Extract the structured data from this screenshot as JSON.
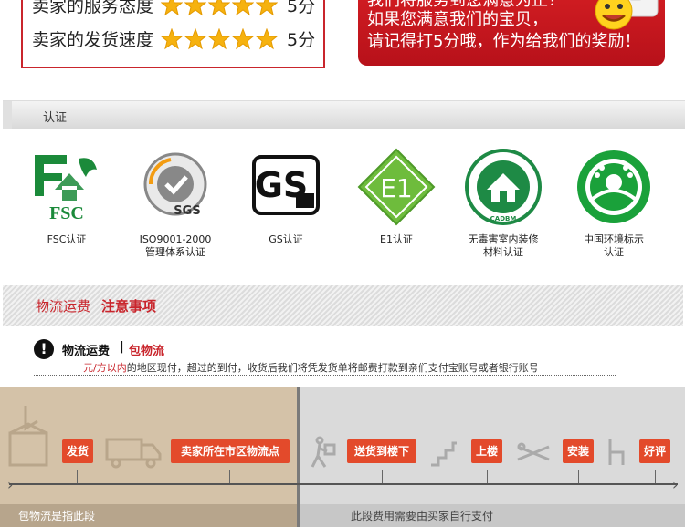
{
  "ratings": [
    {
      "label": "卖家的服务态度",
      "score": "5分",
      "stars": 5
    },
    {
      "label": "卖家的发货速度",
      "score": "5分",
      "stars": 5
    }
  ],
  "banner": {
    "line1": "我们将服务到您满意为止！",
    "line2": "如果您满意我们的宝贝，",
    "line3": "请记得打5分哦，作为给我们的奖励！"
  },
  "cert_section": {
    "title": "认证",
    "items": [
      {
        "caption": "FSC认证",
        "icon": "fsc-icon",
        "logo_text": "FSC"
      },
      {
        "caption": "ISO9001-2000\n管理体系认证",
        "icon": "sgs-icon",
        "logo_text": "SGS"
      },
      {
        "caption": "GS认证",
        "icon": "gs-icon",
        "logo_text": "GS"
      },
      {
        "caption": "E1认证",
        "icon": "e1-icon",
        "logo_text": "E1"
      },
      {
        "caption": "无毒害室内装修\n材料认证",
        "icon": "cadbm-icon",
        "logo_text": "CADBM"
      },
      {
        "caption": "中国环境标示\n认证",
        "icon": "china-environmental-icon",
        "logo_text": ""
      }
    ]
  },
  "logistics": {
    "title_part1": "物流运费",
    "title_part2": "注意事项",
    "notice_label": "物流运费",
    "notice_sep": "|",
    "notice_highlight": "包物流",
    "desc_red": "元/方以内",
    "desc_rest": "的地区现付，超过的到付，收货后我们将凭发货单将邮费打款到亲们支付宝账号或者银行账号"
  },
  "flow": {
    "steps": [
      "发货",
      "卖家所在市区物流点",
      "送货到楼下",
      "上楼",
      "安装",
      "好评"
    ],
    "foot_left": "包物流是指此段",
    "foot_right": "此段费用需要由买家自行支付"
  },
  "colors": {
    "brand_red": "#c9252c",
    "step_orange": "#e34a2b",
    "star_gold": "#f6b20f"
  }
}
